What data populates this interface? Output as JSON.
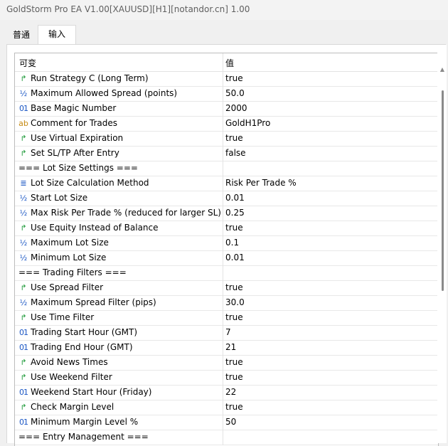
{
  "window": {
    "title": "GoldStorm Pro EA V1.00[XAUUSD][H1][notandor.cn] 1.00"
  },
  "tabs": [
    {
      "label": "普通"
    },
    {
      "label": "输入"
    }
  ],
  "table": {
    "columns": {
      "variable": "可变",
      "value": "值"
    },
    "rows": [
      {
        "kind": "param",
        "icon": "bool-icon",
        "name": "Run Strategy C (Long Term)",
        "value": "true"
      },
      {
        "kind": "param",
        "icon": "fraction-icon",
        "name": "Maximum Allowed Spread (points)",
        "value": "50.0"
      },
      {
        "kind": "param",
        "icon": "integer-icon",
        "name": "Base Magic Number",
        "value": "2000"
      },
      {
        "kind": "param",
        "icon": "string-icon",
        "name": "Comment for Trades",
        "value": "GoldH1Pro"
      },
      {
        "kind": "param",
        "icon": "bool-icon",
        "name": "Use Virtual Expiration",
        "value": "true"
      },
      {
        "kind": "param",
        "icon": "bool-icon",
        "name": "Set SL/TP After Entry",
        "value": "false"
      },
      {
        "kind": "section",
        "name": "=== Lot Size Settings ===",
        "value": ""
      },
      {
        "kind": "param",
        "icon": "enum-icon",
        "name": "Lot Size Calculation Method",
        "value": "Risk Per Trade %"
      },
      {
        "kind": "param",
        "icon": "fraction-icon",
        "name": "Start Lot Size",
        "value": "0.01"
      },
      {
        "kind": "param",
        "icon": "fraction-icon",
        "name": "Max Risk Per Trade % (reduced for larger SL)",
        "value": "0.25"
      },
      {
        "kind": "param",
        "icon": "bool-icon",
        "name": "Use Equity Instead of Balance",
        "value": "true"
      },
      {
        "kind": "param",
        "icon": "fraction-icon",
        "name": "Maximum Lot Size",
        "value": "0.1"
      },
      {
        "kind": "param",
        "icon": "fraction-icon",
        "name": "Minimum Lot Size",
        "value": "0.01"
      },
      {
        "kind": "section",
        "name": "=== Trading Filters ===",
        "value": ""
      },
      {
        "kind": "param",
        "icon": "bool-icon",
        "name": "Use Spread Filter",
        "value": "true"
      },
      {
        "kind": "param",
        "icon": "fraction-icon",
        "name": "Maximum Spread Filter (pips)",
        "value": "30.0"
      },
      {
        "kind": "param",
        "icon": "bool-icon",
        "name": "Use Time Filter",
        "value": "true"
      },
      {
        "kind": "param",
        "icon": "integer-icon",
        "name": "Trading Start Hour (GMT)",
        "value": "7"
      },
      {
        "kind": "param",
        "icon": "integer-icon",
        "name": "Trading End Hour (GMT)",
        "value": "21"
      },
      {
        "kind": "param",
        "icon": "bool-icon",
        "name": "Avoid News Times",
        "value": "true"
      },
      {
        "kind": "param",
        "icon": "bool-icon",
        "name": "Use Weekend Filter",
        "value": "true"
      },
      {
        "kind": "param",
        "icon": "integer-icon",
        "name": "Weekend Start Hour (Friday)",
        "value": "22"
      },
      {
        "kind": "param",
        "icon": "bool-icon",
        "name": "Check Margin Level",
        "value": "true"
      },
      {
        "kind": "param",
        "icon": "integer-icon",
        "name": "Minimum Margin Level %",
        "value": "50"
      },
      {
        "kind": "section",
        "name": "=== Entry Management ===",
        "value": ""
      }
    ]
  }
}
